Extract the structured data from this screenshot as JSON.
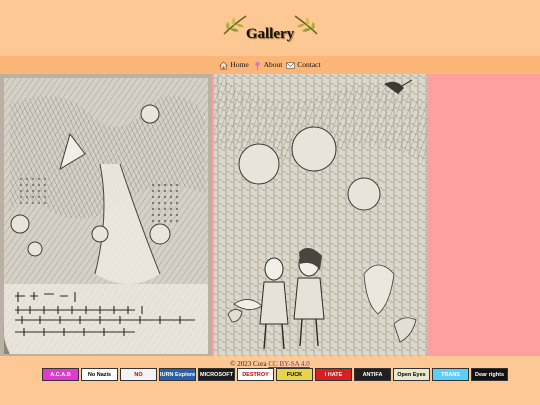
{
  "header": {
    "title": "Gallery"
  },
  "nav": {
    "items": [
      {
        "label": "Home",
        "icon": "house-icon"
      },
      {
        "label": "About",
        "icon": "pin-icon"
      },
      {
        "label": "Contact",
        "icon": "envelope-icon"
      }
    ]
  },
  "footer": {
    "copyright": "© 2023 Cora",
    "license": "CC BY-SA 4.0"
  },
  "badges": [
    {
      "text": "A.C.A.B",
      "bg": "#e03ad0",
      "fg": "#ffffff"
    },
    {
      "text": "No Nazis",
      "bg": "#ffffff",
      "fg": "#000000"
    },
    {
      "text": "NO",
      "bg": "#f4f4f4",
      "fg": "#c00000"
    },
    {
      "text": "BURN Explorer",
      "bg": "#2a5fa8",
      "fg": "#ffffff"
    },
    {
      "text": "MICROSOFT",
      "bg": "#1b1b1b",
      "fg": "#ffffff"
    },
    {
      "text": "DESTROY",
      "bg": "#ffffff",
      "fg": "#cc0000"
    },
    {
      "text": "FUCK",
      "bg": "#e8d44a",
      "fg": "#000000"
    },
    {
      "text": "I HATE",
      "bg": "#d42020",
      "fg": "#ffffff"
    },
    {
      "text": "ANTIFA",
      "bg": "#202020",
      "fg": "#ffffff"
    },
    {
      "text": "Open Eyes",
      "bg": "#e9e9d0",
      "fg": "#000000"
    },
    {
      "text": "TRANS",
      "bg": "#5bcefa",
      "fg": "#ffffff"
    },
    {
      "text": "Dear rights",
      "bg": "#111111",
      "fg": "#ffffff"
    }
  ],
  "colors": {
    "page_bg": "#fec895",
    "nav_bg": "#fbb678",
    "gallery_bg": "#ff9f9f"
  }
}
